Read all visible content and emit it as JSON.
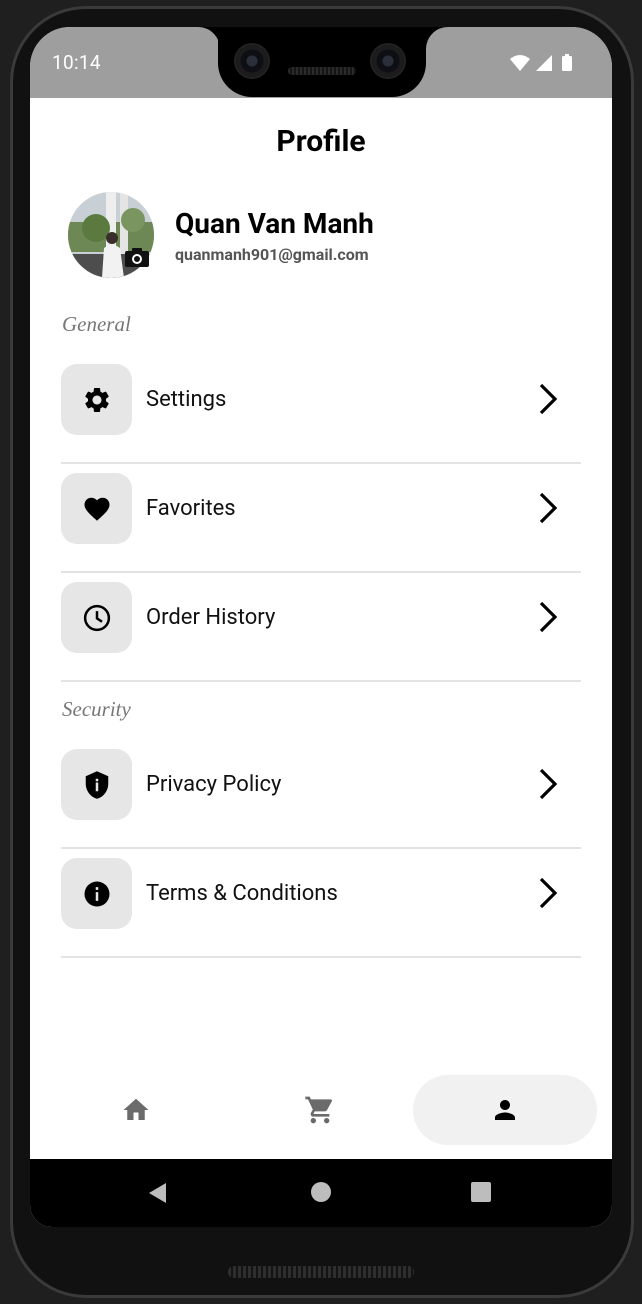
{
  "status_bar": {
    "time": "10:14"
  },
  "page": {
    "title": "Profile"
  },
  "user": {
    "name": "Quan Van Manh",
    "email": "quanmanh901@gmail.com"
  },
  "sections": [
    {
      "label": "General",
      "items": [
        {
          "label": "Settings",
          "icon": "gear-icon"
        },
        {
          "label": "Favorites",
          "icon": "heart-icon"
        },
        {
          "label": "Order History",
          "icon": "clock-icon"
        }
      ]
    },
    {
      "label": "Security",
      "items": [
        {
          "label": "Privacy Policy",
          "icon": "shield-icon"
        },
        {
          "label": "Terms & Conditions",
          "icon": "info-icon"
        }
      ]
    }
  ],
  "bottom_nav": {
    "items": [
      {
        "icon": "home-icon",
        "active": false
      },
      {
        "icon": "cart-icon",
        "active": false
      },
      {
        "icon": "person-icon",
        "active": true
      }
    ]
  },
  "colors": {
    "tile_bg": "#e6e6e6",
    "active_nav_bg": "#f1f1f1",
    "status_bar_bg": "#9e9e9e"
  }
}
